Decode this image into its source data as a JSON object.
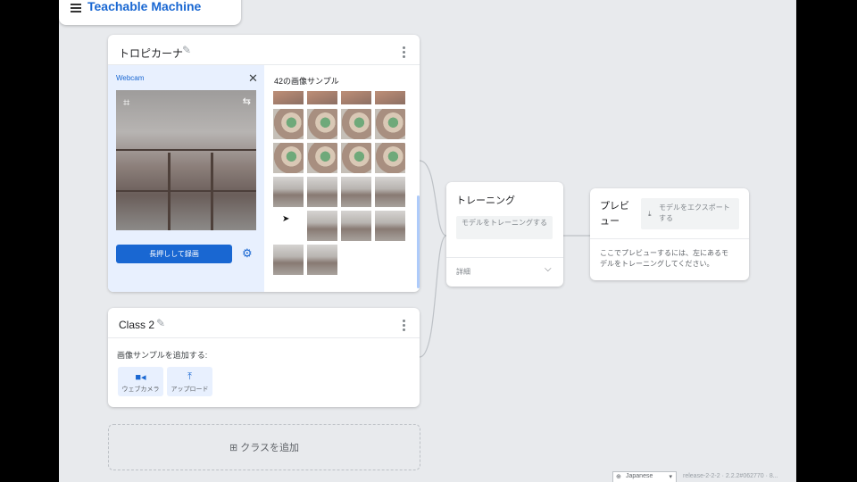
{
  "header": {
    "brand": "Teachable Machine"
  },
  "class1": {
    "name": "トロピカーナ",
    "source_label": "Webcam",
    "record_label": "長押しして録画",
    "sample_count_label": "42の画像サンプル"
  },
  "class2": {
    "name": "Class 2",
    "add_samples_label": "画像サンプルを追加する:",
    "webcam_label": "ウェブカメラ",
    "upload_label": "アップロード"
  },
  "add_class": {
    "label": "クラスを追加"
  },
  "training": {
    "title": "トレーニング",
    "train_button": "モデルをトレーニングする",
    "details": "詳細"
  },
  "preview": {
    "title": "プレビュー",
    "export_button": "モデルをエクスポートする",
    "info": "ここでプレビューするには、左にあるモデルをトレーニングしてください。"
  },
  "footer": {
    "language": "Japanese",
    "release": "release-2-2-2 · 2.2.2#062770 · 8..."
  },
  "colors": {
    "accent": "#1967d2",
    "canvas": "#e8eaed",
    "panel": "#e8f0fe"
  },
  "icons": [
    "menu-icon",
    "edit-icon",
    "more-vert-icon",
    "close-icon",
    "crop-icon",
    "flip-icon",
    "settings-icon",
    "videocam-icon",
    "upload-icon",
    "add-box-icon",
    "chevron-down-icon",
    "download-icon",
    "globe-icon"
  ]
}
